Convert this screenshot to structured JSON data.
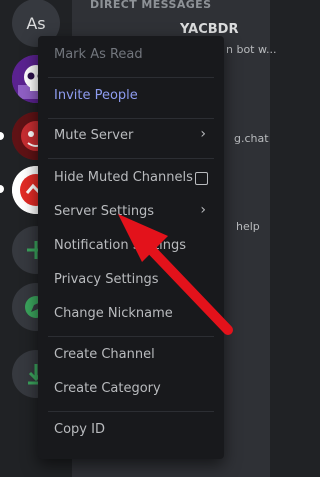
{
  "server_rail": {
    "home_initials": "As",
    "items": [
      {
        "name": "skull-server"
      },
      {
        "name": "red-mascot-server"
      },
      {
        "name": "redtree-server"
      },
      {
        "name": "add-server"
      },
      {
        "name": "explore-servers"
      },
      {
        "name": "download-apps"
      }
    ]
  },
  "channels": {
    "header": "DIRECT MESSAGES",
    "peek": [
      "YACBDR",
      "n bot w...",
      "g.chat",
      "help"
    ]
  },
  "context_menu": {
    "items": [
      {
        "label": "Mark As Read",
        "state": "disabled"
      },
      {
        "label": "Invite People",
        "state": "accent"
      },
      {
        "label": "Mute Server"
      },
      {
        "label": "Hide Muted Channels"
      },
      {
        "label": "Server Settings"
      },
      {
        "label": "Notification Settings"
      },
      {
        "label": "Privacy Settings"
      },
      {
        "label": "Change Nickname"
      },
      {
        "label": "Create Channel"
      },
      {
        "label": "Create Category"
      },
      {
        "label": "Copy ID"
      }
    ]
  },
  "colors": {
    "accent": "#8e9cf0",
    "arrow": "#e3121b",
    "green": "#3ba55d"
  }
}
